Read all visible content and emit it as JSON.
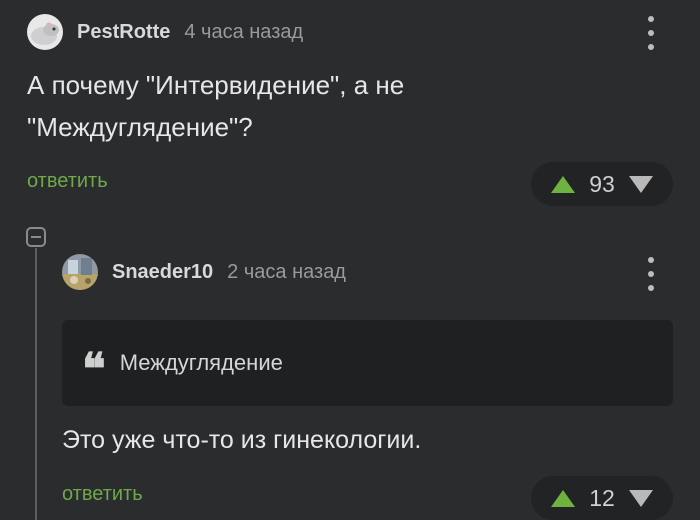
{
  "comments": [
    {
      "author": "PestRotte",
      "time": "4 часа назад",
      "text": "А почему \"Интервидение\", а не \"Междуглядение\"?",
      "reply_label": "ответить",
      "rating": "93"
    },
    {
      "author": "Snaeder10",
      "time": "2 часа назад",
      "quote": "Междуглядение",
      "text": "Это уже что-то из гинекологии.",
      "reply_label": "ответить",
      "rating": "12"
    }
  ],
  "colors": {
    "background": "#2b2c2e",
    "reply_link": "#6ea84a",
    "upvote": "#6fb23f",
    "rating_pill": "#222325",
    "quote_background": "#1f2022"
  },
  "icons": {
    "more": "more-vertical-icon",
    "upvote": "arrow-up-icon",
    "downvote": "arrow-down-icon",
    "quote": "quote-icon",
    "collapse": "collapse-minus-icon"
  }
}
